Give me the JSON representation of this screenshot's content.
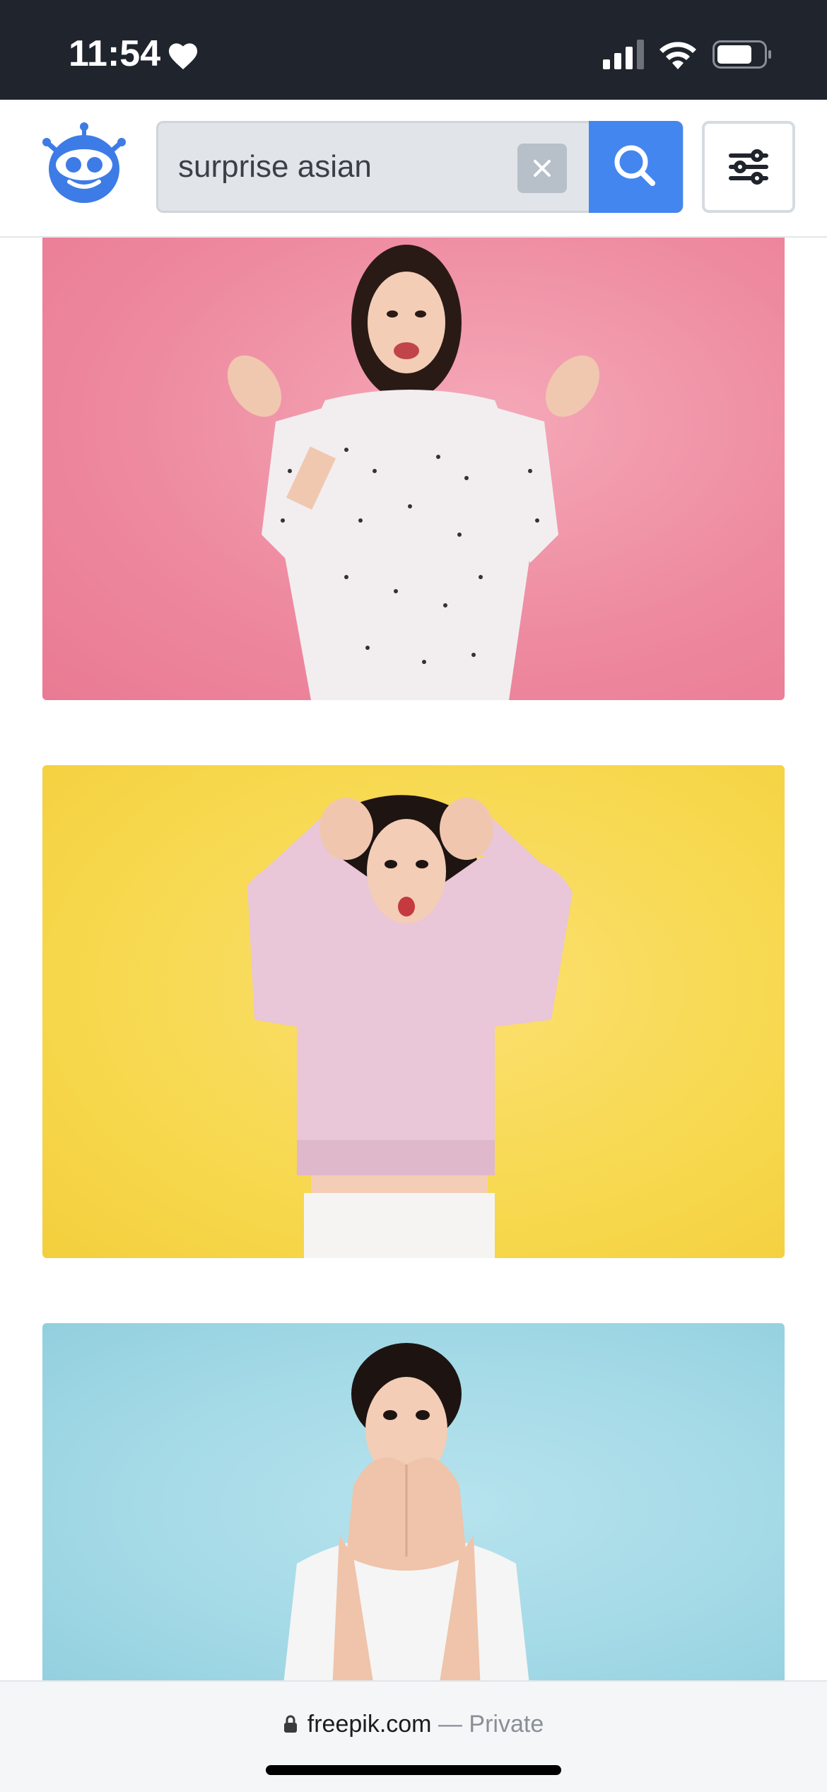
{
  "status_bar": {
    "time": "11:54",
    "icons": [
      "heart-icon",
      "cellular-signal-icon",
      "wifi-icon",
      "battery-icon"
    ]
  },
  "header": {
    "logo_icon": "robot-logo-icon",
    "search": {
      "value": "surprise asian",
      "clear_icon": "close-icon",
      "submit_icon": "search-icon"
    },
    "filter_icon": "sliders-icon"
  },
  "results": [
    {
      "background": "#ee8aa0",
      "subject": "woman-polka-dot-dress"
    },
    {
      "background": "#f7d84e",
      "subject": "woman-pink-sweater"
    },
    {
      "background": "#a3d9e6",
      "subject": "woman-white-tshirt"
    }
  ],
  "browser_bar": {
    "domain": "freepik.com",
    "separator": "—",
    "mode": "Private",
    "lock_icon": "lock-icon"
  },
  "colors": {
    "status_bar": "#1f242d",
    "accent": "#4486ef"
  }
}
